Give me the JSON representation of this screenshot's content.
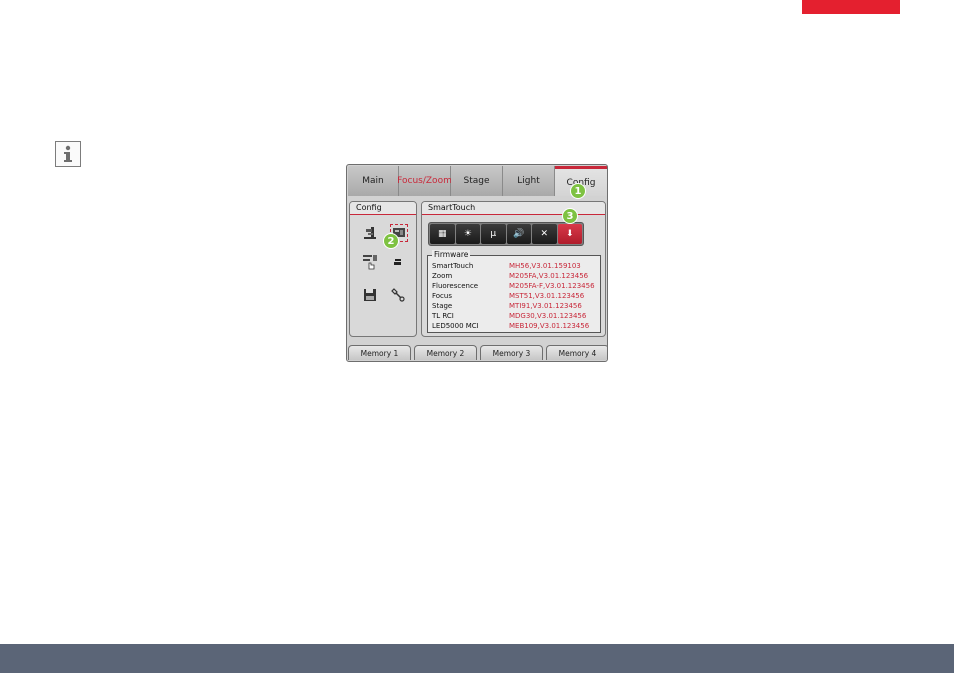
{
  "colors": {
    "accent_red": "#e4202f",
    "footer": "#5b6577",
    "callout_green": "#7ec242"
  },
  "info_icon": "info-icon",
  "device": {
    "tabs": [
      "Main",
      "Focus/Zoom",
      "Stage",
      "Light",
      "Config"
    ],
    "active_tab": "Config",
    "config_panel": {
      "title": "Config",
      "icons": [
        "microscope-icon",
        "display-settings-icon",
        "touch-menu-icon",
        "stack-icon",
        "save-icon",
        "wrench-icon"
      ]
    },
    "smarttouch_panel": {
      "title": "SmartTouch",
      "toolbar": [
        {
          "icon": "layout-icon",
          "label": "▦"
        },
        {
          "icon": "brightness-icon",
          "label": "☀"
        },
        {
          "icon": "micro-icon",
          "label": "μ"
        },
        {
          "icon": "speaker-icon",
          "label": "🔊"
        },
        {
          "icon": "tools-icon",
          "label": "✕"
        },
        {
          "icon": "firmware-icon",
          "label": "⬇"
        }
      ],
      "firmware": {
        "legend": "Firmware",
        "rows": [
          {
            "name": "SmartTouch",
            "value": "MH56,V3.01.159103"
          },
          {
            "name": "Zoom",
            "value": "M205FA,V3.01.123456"
          },
          {
            "name": "Fluorescence",
            "value": "M205FA-F,V3.01.123456"
          },
          {
            "name": "Focus",
            "value": "MST51,V3.01.123456"
          },
          {
            "name": "Stage",
            "value": "MTI91,V3.01.123456"
          },
          {
            "name": "TL RCI",
            "value": "MDG30,V3.01.123456"
          },
          {
            "name": "LED5000 MCI",
            "value": "MEB109,V3.01.123456"
          }
        ]
      }
    },
    "memory_buttons": [
      "Memory 1",
      "Memory 2",
      "Memory 3",
      "Memory 4"
    ]
  },
  "callouts": [
    "1",
    "2",
    "3"
  ]
}
